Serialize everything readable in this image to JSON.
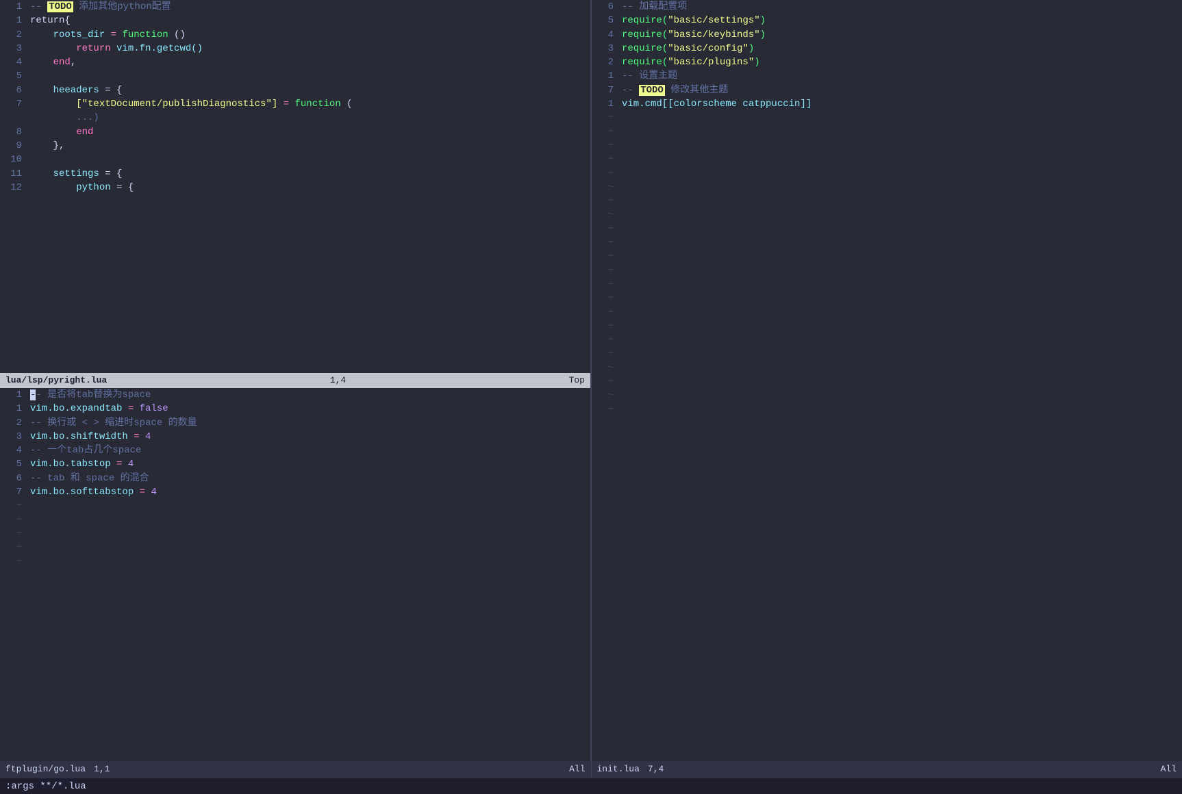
{
  "left_top_lines": [
    {
      "num": "1",
      "content": [
        {
          "t": "-- ",
          "cls": "c-comment"
        },
        {
          "t": "TODO",
          "cls": "c-todo"
        },
        {
          "t": " 添加其他python配置",
          "cls": "c-comment"
        }
      ]
    },
    {
      "num": "1",
      "content": [
        {
          "t": "return{",
          "cls": "c-punct"
        }
      ]
    },
    {
      "num": "2",
      "content": [
        {
          "t": "    roots_dir ",
          "cls": "c-var"
        },
        {
          "t": "=",
          "cls": "c-eq"
        },
        {
          "t": " function ",
          "cls": "c-func"
        },
        {
          "t": "()",
          "cls": "c-punct"
        }
      ]
    },
    {
      "num": "3",
      "content": [
        {
          "t": "        return ",
          "cls": "c-keyword"
        },
        {
          "t": "vim.fn.getcwd()",
          "cls": "c-var"
        }
      ]
    },
    {
      "num": "4",
      "content": [
        {
          "t": "    ",
          "cls": ""
        },
        {
          "t": "end",
          "cls": "c-keyword"
        },
        {
          "t": ",",
          "cls": "c-punct"
        }
      ]
    },
    {
      "num": "5",
      "content": []
    },
    {
      "num": "6",
      "content": [
        {
          "t": "    heeaders ",
          "cls": "c-var"
        },
        {
          "t": "= {",
          "cls": "c-punct"
        }
      ]
    },
    {
      "num": "7",
      "content": [
        {
          "t": "        [\"textDocument/publishDiagnostics\"] ",
          "cls": "c-string"
        },
        {
          "t": "= ",
          "cls": "c-eq"
        },
        {
          "t": "function ",
          "cls": "c-func"
        },
        {
          "t": "(",
          "cls": "c-punct"
        }
      ]
    },
    {
      "num": "",
      "content": [
        {
          "t": "        ...)",
          "cls": "c-comment"
        }
      ]
    },
    {
      "num": "8",
      "content": [
        {
          "t": "        ",
          "cls": ""
        },
        {
          "t": "end",
          "cls": "c-keyword"
        }
      ]
    },
    {
      "num": "9",
      "content": [
        {
          "t": "    },",
          "cls": "c-punct"
        }
      ]
    },
    {
      "num": "10",
      "content": []
    },
    {
      "num": "11",
      "content": [
        {
          "t": "    settings ",
          "cls": "c-var"
        },
        {
          "t": "= {",
          "cls": "c-punct"
        }
      ]
    },
    {
      "num": "12",
      "content": [
        {
          "t": "        python ",
          "cls": "c-var"
        },
        {
          "t": "= {",
          "cls": "c-punct"
        }
      ]
    }
  ],
  "mid_status": {
    "filename": "lua/lsp/pyright.lua",
    "pos": "1,4",
    "extra": "Top"
  },
  "left_bottom_lines": [
    {
      "num": "1",
      "content": [
        {
          "t": "-- ",
          "cls": "c-comment"
        },
        {
          "t": "-- ",
          "cls": "c-comment"
        },
        {
          "t": "是否将tab替换为space",
          "cls": "c-comment"
        }
      ]
    },
    {
      "num": "1",
      "content": [
        {
          "t": "vim.bo.expandtab ",
          "cls": "c-var"
        },
        {
          "t": "= ",
          "cls": "c-eq"
        },
        {
          "t": "false",
          "cls": "c-false"
        }
      ]
    },
    {
      "num": "2",
      "content": [
        {
          "t": "-- 换行或 < > 缩进时space 的数量",
          "cls": "c-comment"
        }
      ]
    },
    {
      "num": "3",
      "content": [
        {
          "t": "vim.bo.shiftwidth ",
          "cls": "c-var"
        },
        {
          "t": "= ",
          "cls": "c-eq"
        },
        {
          "t": "4",
          "cls": "c-number"
        }
      ]
    },
    {
      "num": "4",
      "content": [
        {
          "t": "-- 一个tab占几个space",
          "cls": "c-comment"
        }
      ]
    },
    {
      "num": "5",
      "content": [
        {
          "t": "vim.bo.tabstop ",
          "cls": "c-var"
        },
        {
          "t": "= ",
          "cls": "c-eq"
        },
        {
          "t": "4",
          "cls": "c-number"
        }
      ]
    },
    {
      "num": "6",
      "content": [
        {
          "t": "-- tab 和 space 的混合",
          "cls": "c-comment"
        }
      ]
    },
    {
      "num": "7",
      "content": [
        {
          "t": "vim.bo.softtabstop ",
          "cls": "c-var"
        },
        {
          "t": "= ",
          "cls": "c-eq"
        },
        {
          "t": "4",
          "cls": "c-number"
        }
      ]
    },
    {
      "num": "~",
      "content": [],
      "tilde": true
    },
    {
      "num": "~",
      "content": [],
      "tilde": true
    },
    {
      "num": "~",
      "content": [],
      "tilde": true
    },
    {
      "num": "~",
      "content": [],
      "tilde": true
    },
    {
      "num": "~",
      "content": [],
      "tilde": true
    }
  ],
  "right_lines": [
    {
      "num": "6",
      "content": [
        {
          "t": "-- 加载配置项",
          "cls": "c-comment"
        }
      ]
    },
    {
      "num": "5",
      "content": [
        {
          "t": "require(",
          "cls": "c-func"
        },
        {
          "t": "\"basic/settings\"",
          "cls": "c-string"
        },
        {
          "t": ")",
          "cls": "c-func"
        }
      ]
    },
    {
      "num": "4",
      "content": [
        {
          "t": "require(",
          "cls": "c-func"
        },
        {
          "t": "\"basic/keybinds\"",
          "cls": "c-string"
        },
        {
          "t": ")",
          "cls": "c-func"
        }
      ]
    },
    {
      "num": "3",
      "content": [
        {
          "t": "require(",
          "cls": "c-func"
        },
        {
          "t": "\"basic/config\"",
          "cls": "c-string"
        },
        {
          "t": ")",
          "cls": "c-func"
        }
      ]
    },
    {
      "num": "2",
      "content": [
        {
          "t": "require(",
          "cls": "c-func"
        },
        {
          "t": "\"basic/plugins\"",
          "cls": "c-string"
        },
        {
          "t": ")",
          "cls": "c-func"
        }
      ]
    },
    {
      "num": "1",
      "content": [
        {
          "t": "-- 设置主题",
          "cls": "c-comment"
        }
      ]
    },
    {
      "num": "7",
      "content": [
        {
          "t": "-- ",
          "cls": "c-comment"
        },
        {
          "t": "TODO",
          "cls": "c-todo"
        },
        {
          "t": " 修改其他主题",
          "cls": "c-comment"
        }
      ]
    },
    {
      "num": "1",
      "content": [
        {
          "t": "vim.cmd[[colorscheme catppuccin]]",
          "cls": "c-var"
        }
      ]
    },
    {
      "num": "~",
      "content": [],
      "tilde": true
    },
    {
      "num": "~",
      "content": [],
      "tilde": true
    },
    {
      "num": "~",
      "content": [],
      "tilde": true
    },
    {
      "num": "~",
      "content": [],
      "tilde": true
    },
    {
      "num": "~",
      "content": [],
      "tilde": true
    },
    {
      "num": "~",
      "content": [],
      "tilde": true
    },
    {
      "num": "~",
      "content": [],
      "tilde": true
    },
    {
      "num": "~",
      "content": [],
      "tilde": true
    },
    {
      "num": "~",
      "content": [],
      "tilde": true
    },
    {
      "num": "~",
      "content": [],
      "tilde": true
    },
    {
      "num": "~",
      "content": [],
      "tilde": true
    },
    {
      "num": "~",
      "content": [],
      "tilde": true
    },
    {
      "num": "~",
      "content": [],
      "tilde": true
    },
    {
      "num": "~",
      "content": [],
      "tilde": true
    },
    {
      "num": "~",
      "content": [],
      "tilde": true
    },
    {
      "num": "~",
      "content": [],
      "tilde": true
    },
    {
      "num": "~",
      "content": [],
      "tilde": true
    },
    {
      "num": "~",
      "content": [],
      "tilde": true
    },
    {
      "num": "~",
      "content": [],
      "tilde": true
    },
    {
      "num": "~",
      "content": [],
      "tilde": true
    },
    {
      "num": "~",
      "content": [],
      "tilde": true
    },
    {
      "num": "~",
      "content": [],
      "tilde": true
    }
  ],
  "bottom_status": {
    "left_filename": "ftplugin/go.lua",
    "left_pos": "1,1",
    "left_extra": "All",
    "right_filename": "init.lua",
    "right_pos": "7,4",
    "right_extra": "All"
  },
  "command_line": ":args **/*.lua"
}
